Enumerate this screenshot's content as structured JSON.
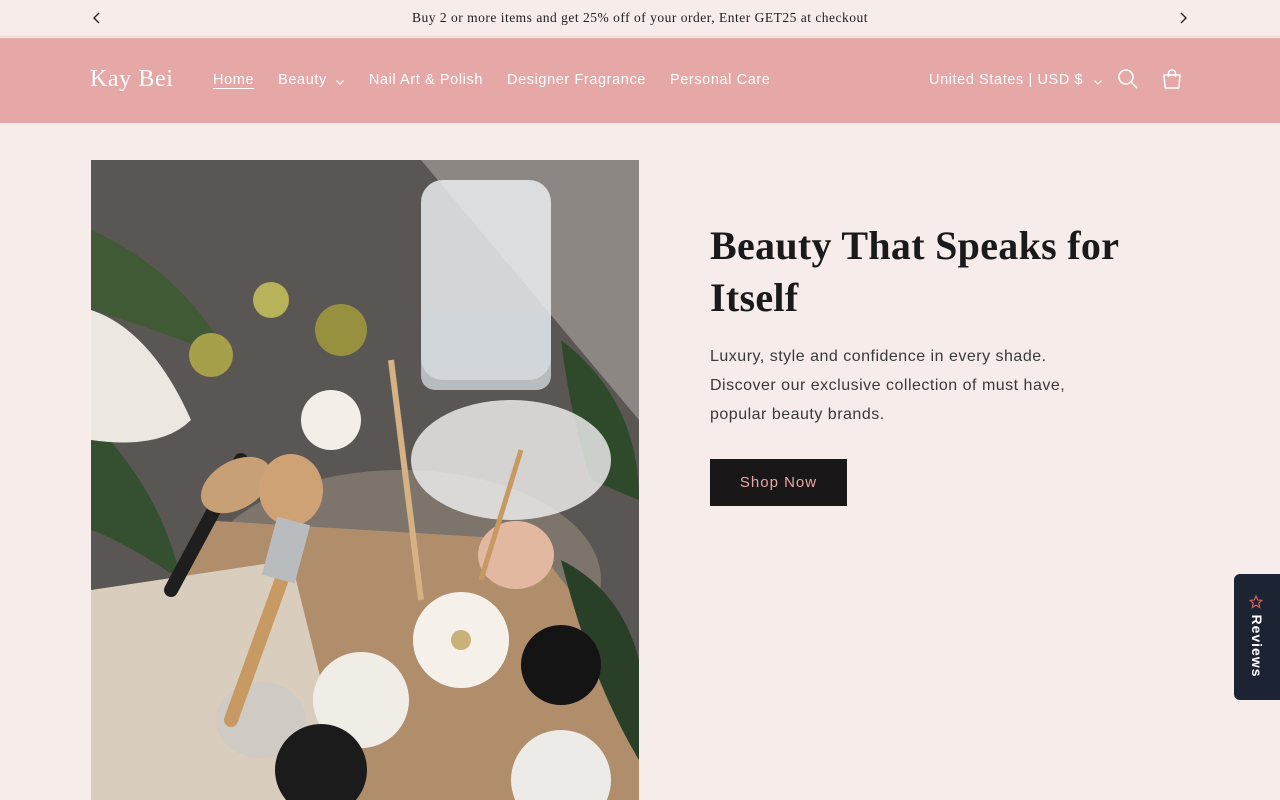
{
  "announcement": {
    "message": "Buy 2 or more items and get 25% off of your order, Enter GET25 at checkout",
    "prev_icon": "chevron-left-icon",
    "next_icon": "chevron-right-icon"
  },
  "header": {
    "logo": "Kay Bei",
    "nav": [
      {
        "label": "Home",
        "active": true
      },
      {
        "label": "Beauty",
        "has_dropdown": true
      },
      {
        "label": "Nail Art & Polish"
      },
      {
        "label": "Designer Fragrance"
      },
      {
        "label": "Personal Care"
      }
    ],
    "locale": "United States | USD $",
    "search_icon": "search-icon",
    "cart_icon": "cart-icon"
  },
  "hero": {
    "title": "Beauty That Speaks for Itself",
    "text": "Luxury, style and confidence in every shade. Discover our exclusive collection of must have, popular beauty brands.",
    "button": "Shop Now"
  },
  "reviews_tab": {
    "label": "Reviews",
    "icon": "star-icon"
  },
  "colors": {
    "background": "#f6ecea",
    "header": "#e6a7a7",
    "button_bg": "#1a1718",
    "button_text": "#e6a7a7",
    "reviews_bg": "#1c2434"
  }
}
